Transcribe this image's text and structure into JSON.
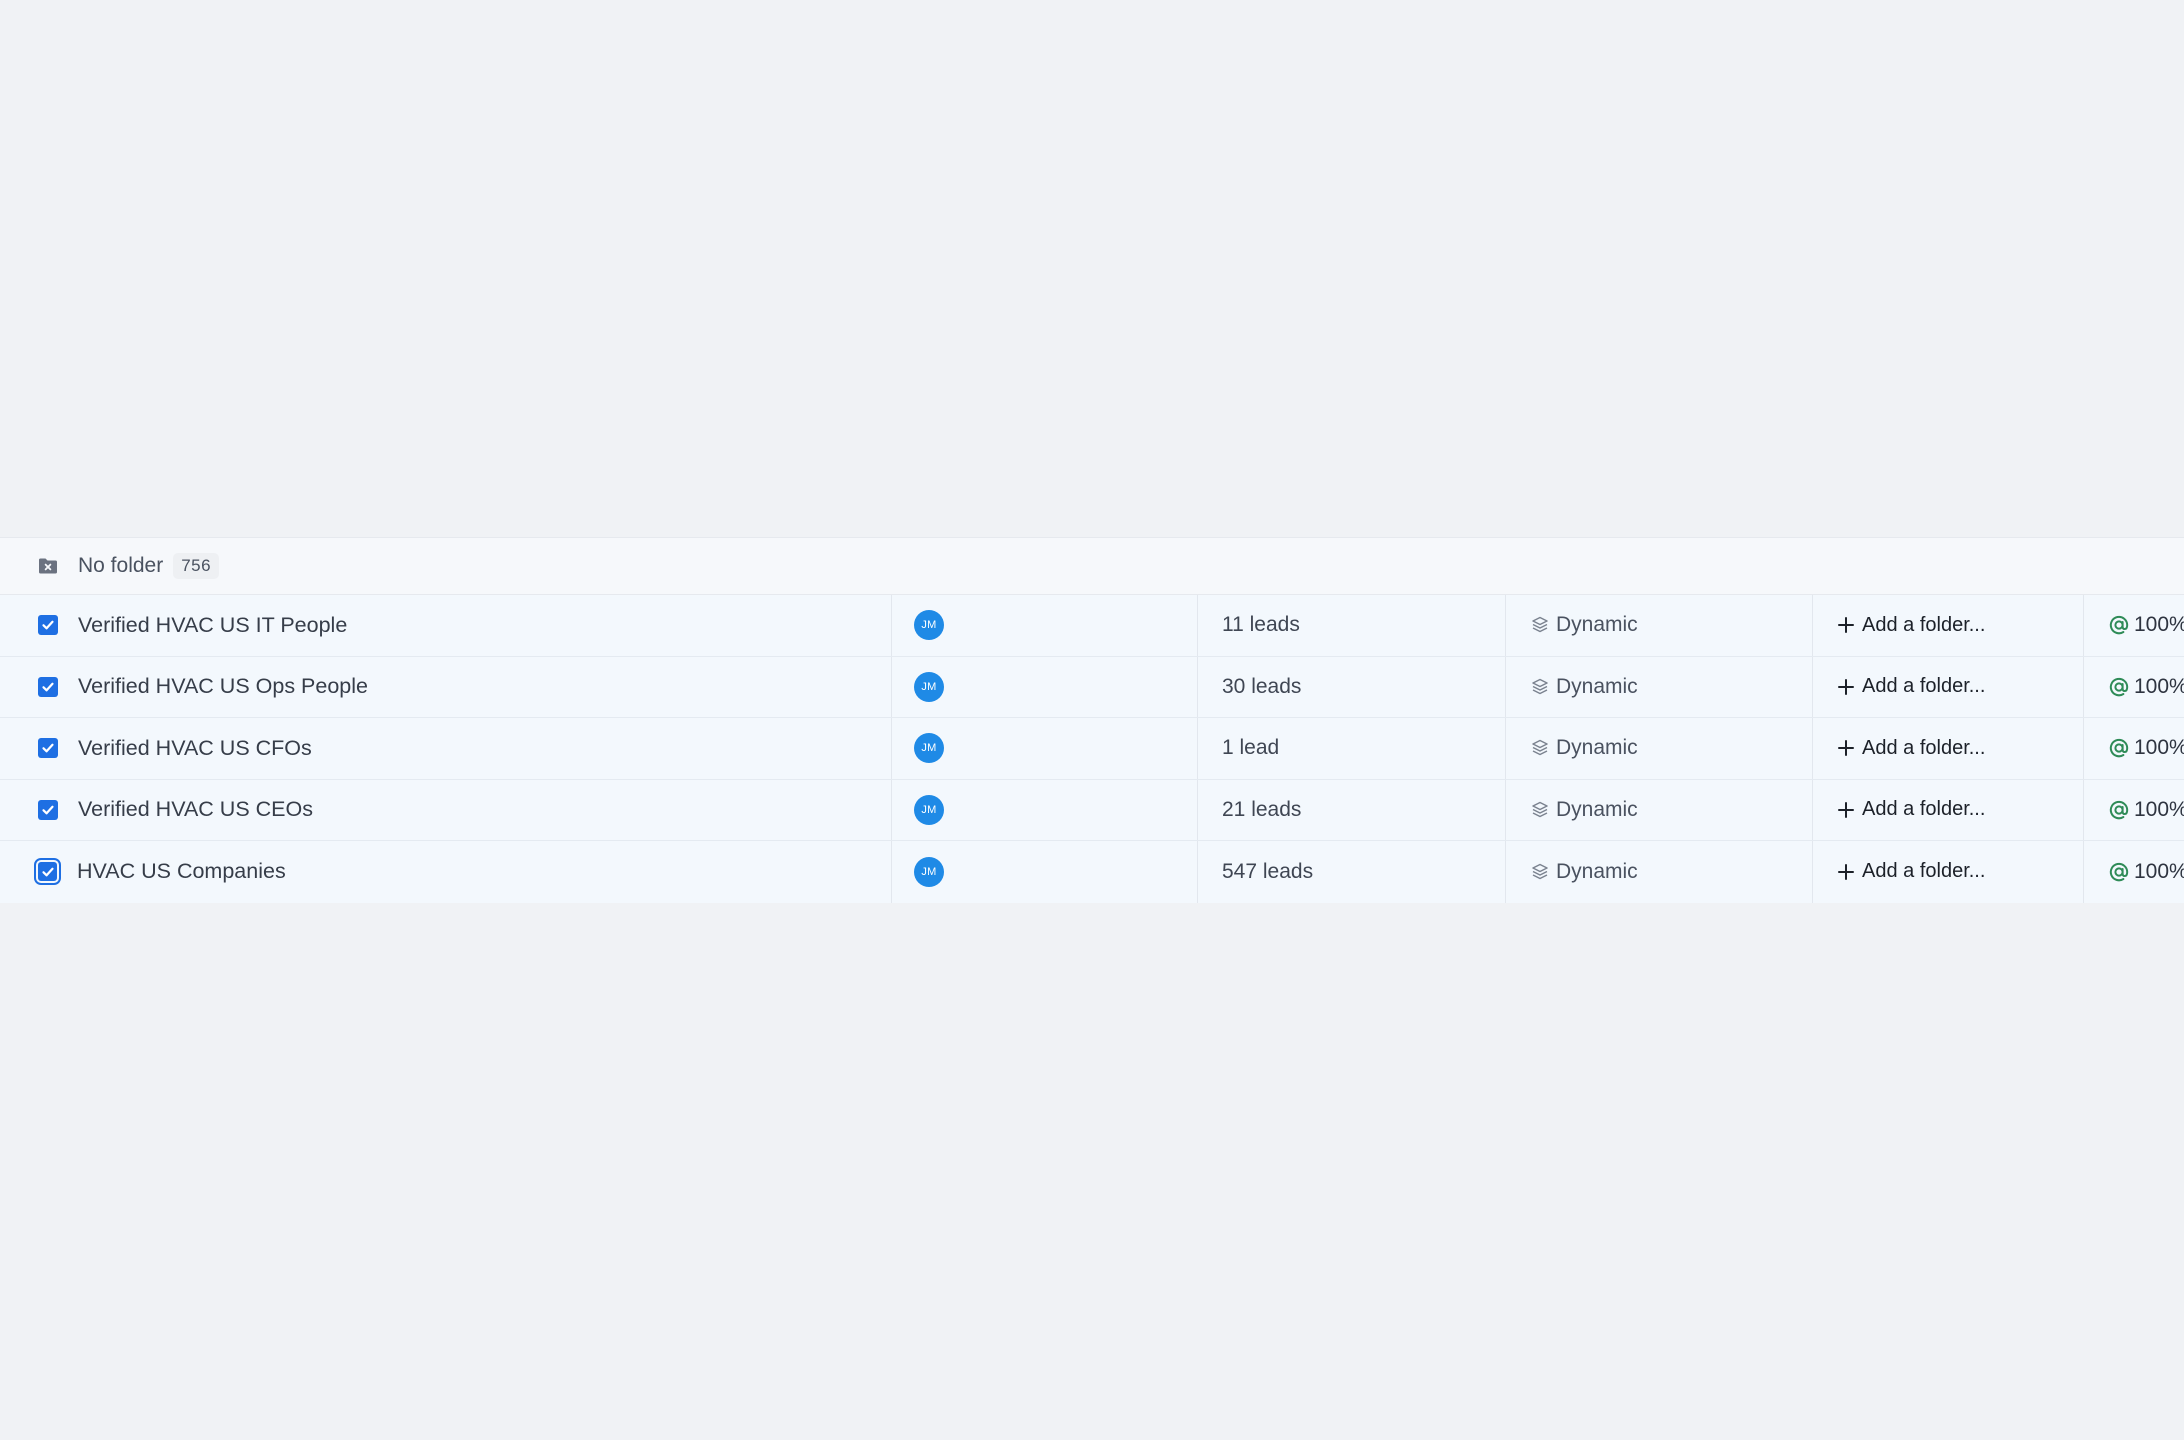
{
  "folder_group": {
    "label": "No folder",
    "count": "756",
    "icon": "folder-x-icon"
  },
  "columns": {
    "check_icon": "checkbox-check-icon",
    "type_icon": "layers-icon",
    "add_icon": "plus-icon",
    "pct_icon": "at-icon"
  },
  "rows": [
    {
      "checked": true,
      "name": "Verified HVAC US IT People",
      "owner_initials": "JM",
      "leads": "11 leads",
      "type": "Dynamic",
      "folder_action": "Add a folder...",
      "pct": "100%"
    },
    {
      "checked": true,
      "name": "Verified HVAC US Ops People",
      "owner_initials": "JM",
      "leads": "30 leads",
      "type": "Dynamic",
      "folder_action": "Add a folder...",
      "pct": "100%"
    },
    {
      "checked": true,
      "name": "Verified HVAC US CFOs",
      "owner_initials": "JM",
      "leads": "1 lead",
      "type": "Dynamic",
      "folder_action": "Add a folder...",
      "pct": "100%"
    },
    {
      "checked": true,
      "name": "Verified HVAC US CEOs",
      "owner_initials": "JM",
      "leads": "21 leads",
      "type": "Dynamic",
      "folder_action": "Add a folder...",
      "pct": "100%"
    },
    {
      "checked": true,
      "name": "HVAC US Companies",
      "owner_initials": "JM",
      "leads": "547 leads",
      "type": "Dynamic",
      "folder_action": "Add a folder...",
      "pct": "100%"
    }
  ],
  "colors": {
    "background": "#f0f2f5",
    "row_background": "#f3f8fd",
    "checkbox": "#1e6fe3",
    "avatar": "#1f8ae6",
    "pct_icon": "#2e8b57"
  }
}
